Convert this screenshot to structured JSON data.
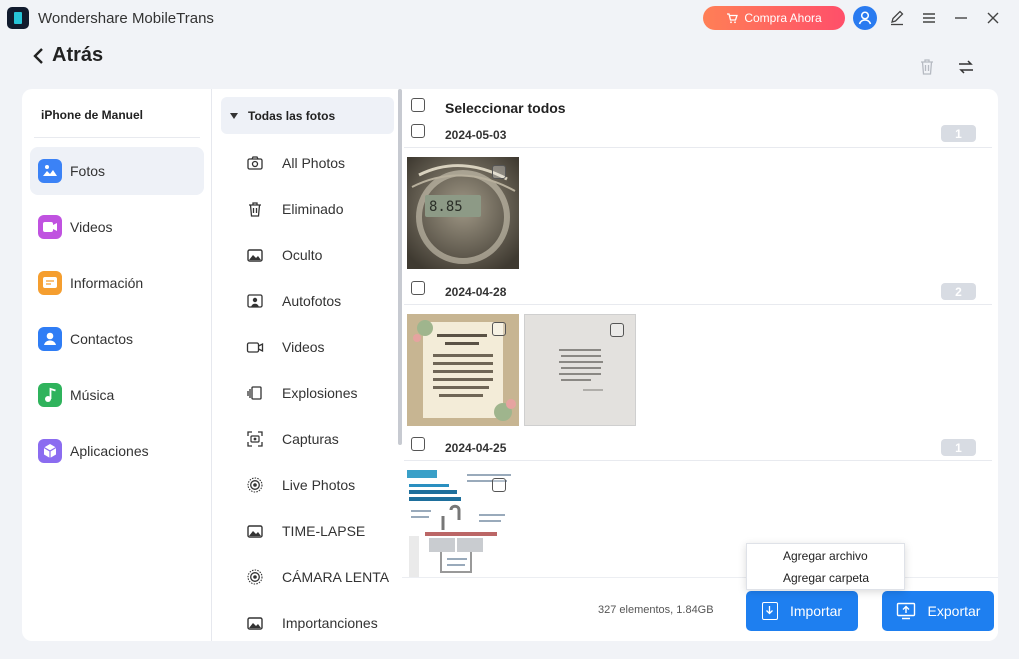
{
  "app": {
    "title": "Wondershare MobileTrans",
    "buy_label": "Compra Ahora"
  },
  "header": {
    "back_label": "Atrás"
  },
  "device": {
    "name": "iPhone de Manuel"
  },
  "categories": [
    {
      "label": "Fotos",
      "icon": "photos-icon",
      "color": "#3b82f6",
      "active": true
    },
    {
      "label": "Videos",
      "icon": "videos-icon",
      "color": "#c052e0",
      "active": false
    },
    {
      "label": "Información",
      "icon": "messages-icon",
      "color": "#f59e2f",
      "active": false
    },
    {
      "label": "Contactos",
      "icon": "contacts-icon",
      "color": "#2f7df5",
      "active": false
    },
    {
      "label": "Música",
      "icon": "music-icon",
      "color": "#2fb35c",
      "active": false
    },
    {
      "label": "Aplicaciones",
      "icon": "apps-icon",
      "color": "#8b6cf0",
      "active": false
    }
  ],
  "albums": {
    "header": "Todas las fotos",
    "items": [
      {
        "label": "All Photos",
        "icon": "camera-icon"
      },
      {
        "label": "Eliminado",
        "icon": "trash-icon"
      },
      {
        "label": "Oculto",
        "icon": "hidden-album-icon"
      },
      {
        "label": "Autofotos",
        "icon": "selfie-icon"
      },
      {
        "label": "Videos",
        "icon": "video-camera-icon"
      },
      {
        "label": "Explosiones",
        "icon": "burst-icon"
      },
      {
        "label": "Capturas",
        "icon": "screenshot-icon"
      },
      {
        "label": "Live Photos",
        "icon": "live-photo-icon"
      },
      {
        "label": "TIME-LAPSE",
        "icon": "timelapse-icon"
      },
      {
        "label": "CÁMARA LENTA",
        "icon": "slow-motion-icon"
      },
      {
        "label": "Importanciones",
        "icon": "imports-icon"
      }
    ]
  },
  "photos": {
    "select_all_label": "Seleccionar todos",
    "groups": [
      {
        "date": "2024-05-03",
        "count": "1"
      },
      {
        "date": "2024-04-28",
        "count": "2"
      },
      {
        "date": "2024-04-25",
        "count": "1"
      }
    ]
  },
  "footer": {
    "stats": "327 elementos, 1.84GB",
    "import_label": "Importar",
    "export_label": "Exportar"
  },
  "import_menu": {
    "add_file": "Agregar archivo",
    "add_folder": "Agregar carpeta"
  }
}
